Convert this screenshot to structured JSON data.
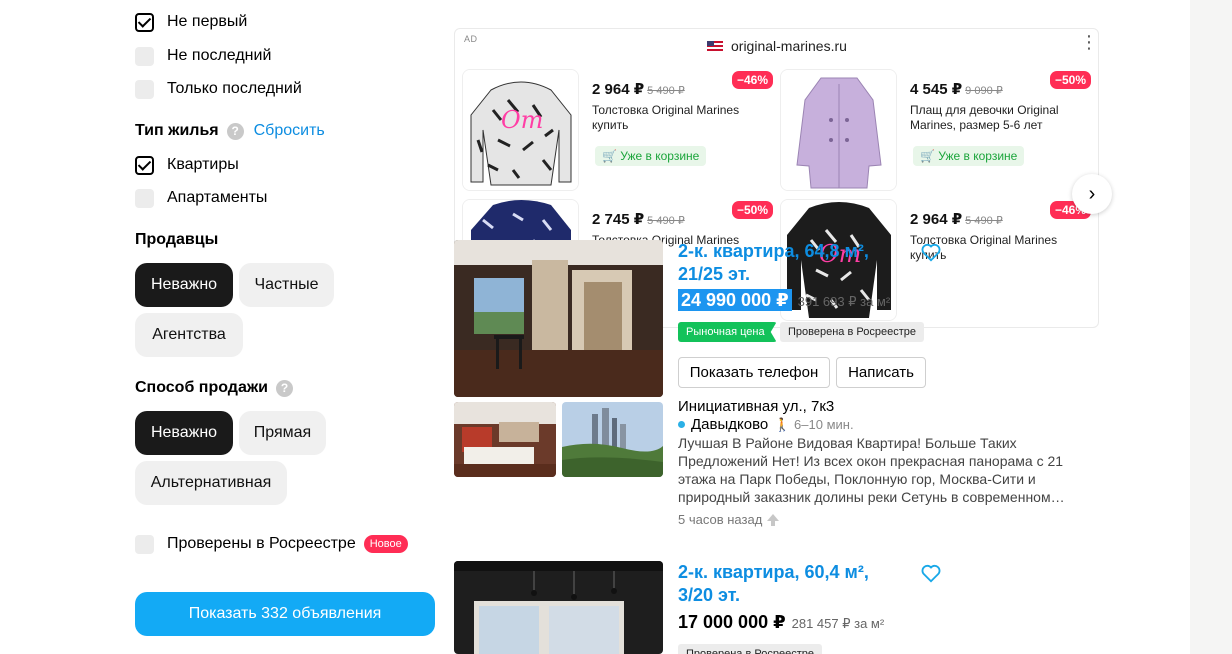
{
  "filters": {
    "floor_options": [
      {
        "label": "Не первый",
        "checked": true
      },
      {
        "label": "Не последний",
        "checked": false
      },
      {
        "label": "Только последний",
        "checked": false
      }
    ],
    "housing_type": {
      "title": "Тип жилья",
      "help": "?",
      "reset": "Сбросить",
      "options": [
        {
          "label": "Квартиры",
          "checked": true
        },
        {
          "label": "Апартаменты",
          "checked": false
        }
      ]
    },
    "sellers": {
      "title": "Продавцы",
      "options": [
        "Неважно",
        "Частные",
        "Агентства"
      ],
      "active": "Неважно"
    },
    "sale_method": {
      "title": "Способ продажи",
      "help": "?",
      "options": [
        "Неважно",
        "Прямая",
        "Альтернативная"
      ],
      "active": "Неважно"
    },
    "rosreestr": {
      "label": "Проверены в Росреестре",
      "badge": "Новое",
      "checked": false
    },
    "show_button": "Показать 332 объявления"
  },
  "ad": {
    "label": "AD",
    "domain": "original-marines.ru",
    "more": "⋮",
    "next": "›",
    "products": [
      {
        "discount": "−46%",
        "price": "2 964 ₽",
        "old_price": "5 490 ₽",
        "title": "Толстовка Original Marines купить",
        "cart": "Уже в корзине"
      },
      {
        "discount": "−50%",
        "price": "4 545 ₽",
        "old_price": "9 090 ₽",
        "title": "Плащ для девочки Original Marines, размер 5-6 лет",
        "cart": "Уже в корзине"
      },
      {
        "discount": "−50%",
        "price": "2 745 ₽",
        "old_price": "5 490 ₽",
        "title": "Толстовка Original Marines"
      },
      {
        "discount": "−46%",
        "price": "2 964 ₽",
        "old_price": "5 490 ₽",
        "title": "Толстовка Original Marines купить"
      }
    ]
  },
  "listings": [
    {
      "title": "2-к. квартира, 64,8 м², 21/25 эт.",
      "price": "24 990 000 ₽",
      "price_per_m2": "391 693 ₽ за м²",
      "tags": [
        "Рыночная цена",
        "Проверена в Росреестре"
      ],
      "buttons": [
        "Показать телефон",
        "Написать"
      ],
      "address": "Инициативная ул., 7к3",
      "metro": "Давыдково",
      "metro_time": "6–10 мин.",
      "description": "Лучшая В Районе Видовая Квартира! Больше Таких Предложений Нет! Из всех окон прекрасная панорама с 21 этажа на Парк Победы, Поклонную гор, Москва-Сити и природный заказник долины реки Сетунь в современном…",
      "time": "5 часов назад"
    },
    {
      "title": "2-к. квартира, 60,4 м², 3/20 эт.",
      "price": "17 000 000 ₽",
      "price_per_m2": "281 457 ₽ за м²",
      "tags": [
        "Проверена в Росреестре"
      ]
    }
  ],
  "colors": {
    "accent": "#0d8de1",
    "button": "#13aaf5",
    "discount": "#ff2d55",
    "market": "#13c25a"
  }
}
